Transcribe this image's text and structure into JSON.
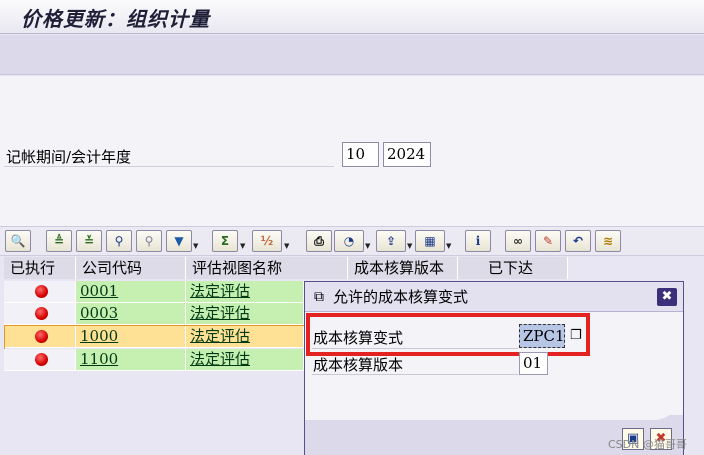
{
  "window": {
    "title": "价格更新：组织计量"
  },
  "selection": {
    "period_label": "记帐期间/会计年度",
    "period_value": "10",
    "year_value": "2024"
  },
  "toolbar": {
    "buttons": [
      {
        "icon": "details-icon",
        "glyph": "🔍"
      },
      {
        "icon": "sort-ascending-icon",
        "glyph": "≜"
      },
      {
        "icon": "sort-descending-icon",
        "glyph": "≚"
      },
      {
        "icon": "find-icon",
        "glyph": "⚲"
      },
      {
        "icon": "find-next-icon",
        "glyph": "⚲"
      },
      {
        "icon": "filter-icon",
        "glyph": "▼"
      },
      {
        "icon": "sum-icon",
        "glyph": "Σ"
      },
      {
        "icon": "subtotal-icon",
        "glyph": "½"
      },
      {
        "icon": "print-icon",
        "glyph": "⎙"
      },
      {
        "icon": "views-icon",
        "glyph": "◔"
      },
      {
        "icon": "export-icon",
        "glyph": "⇪"
      },
      {
        "icon": "layout-icon",
        "glyph": "▦"
      },
      {
        "icon": "info-icon",
        "glyph": "i"
      },
      {
        "icon": "glasses-icon",
        "glyph": "∞"
      },
      {
        "icon": "execute-wand-icon",
        "glyph": "✎"
      },
      {
        "icon": "undo-icon",
        "glyph": "↶"
      },
      {
        "icon": "log-icon",
        "glyph": "📜"
      }
    ]
  },
  "grid": {
    "headers": [
      "已执行",
      "公司代码",
      "评估视图名称",
      "成本核算版本",
      "已下达"
    ],
    "rows": [
      {
        "company": "0001",
        "view": "法定评估",
        "status": "red"
      },
      {
        "company": "0003",
        "view": "法定评估",
        "status": "red"
      },
      {
        "company": "1000",
        "view": "法定评估",
        "status": "red",
        "selected": true
      },
      {
        "company": "1100",
        "view": "法定评估",
        "status": "red"
      }
    ]
  },
  "dialog": {
    "title": "允许的成本核算变式",
    "field1_label": "成本核算变式",
    "field1_value": "ZPC1",
    "field2_label": "成本核算版本",
    "field2_value": "01",
    "close_glyph": "✖"
  },
  "colors": {
    "status_red": "#d40000",
    "row_green": "#c6f0b2",
    "row_selected": "#ffe195",
    "highlight_border": "#e32222",
    "dialog_border": "#5b4e88"
  },
  "watermark": "CSDN @猫哥哥"
}
